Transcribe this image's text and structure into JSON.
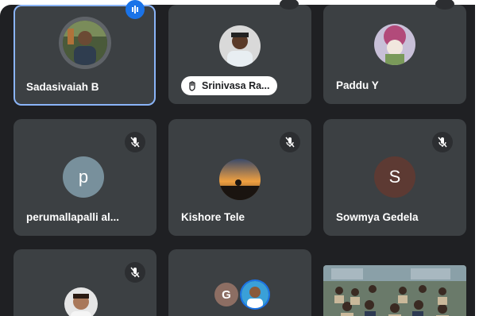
{
  "app": "Video meeting grid view",
  "participants": [
    {
      "name": "Sadasivaiah B",
      "active": true
    },
    {
      "name": "Srinivasa Ra...",
      "hand_raised": true
    },
    {
      "name": "Paddu Y"
    },
    {
      "name": "perumallapalli al...",
      "avatar_letter": "p",
      "avatar_color": "#78909c",
      "muted": true
    },
    {
      "name": "Kishore Tele",
      "muted": true
    },
    {
      "name": "Sowmya Gedela",
      "avatar_letter": "S",
      "avatar_color": "#5d3a33",
      "muted": true
    },
    {
      "name": "",
      "muted": true
    },
    {
      "name": "",
      "group_letter": "G",
      "group_color": "#8d6e63"
    },
    {
      "name": ""
    }
  ],
  "colors": {
    "background": "#1f2023",
    "tile": "#3c4043",
    "active_border": "#8ab4f8",
    "accent_blue": "#1a73e8"
  },
  "icons": [
    "mic-off-icon",
    "raised-hand-icon",
    "speaking-indicator-icon"
  ]
}
